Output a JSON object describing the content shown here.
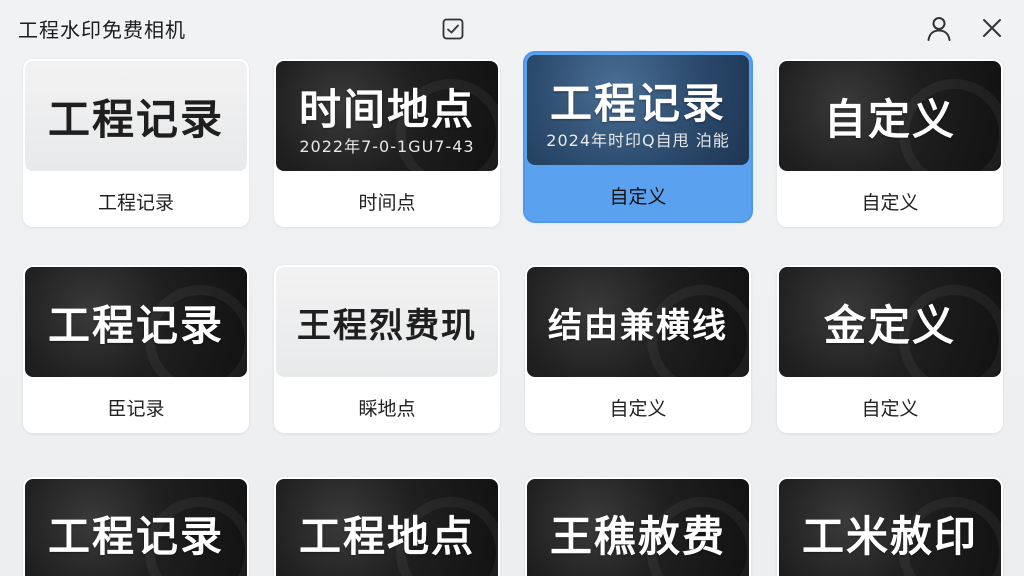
{
  "app": {
    "title": "工程水印免费相机"
  },
  "icons": {
    "check": "checkbox-icon",
    "user": "user-icon",
    "close": "close-icon"
  },
  "colors": {
    "accent": "#5aa2f0",
    "background": "#eef0f2",
    "card": "#ffffff"
  },
  "cards": [
    {
      "title": "工程记录",
      "sub": "",
      "label": "工程记录",
      "style": "light",
      "selected": false
    },
    {
      "title": "时间地点",
      "sub": "2022年7-0-1GU7-43",
      "label": "时间点",
      "style": "dark",
      "selected": false
    },
    {
      "title": "工程记录",
      "sub": "2024年时印Q自甩 泊能",
      "label": "自定义",
      "style": "blue",
      "selected": true
    },
    {
      "title": "自定义",
      "sub": "",
      "label": "自定义",
      "style": "dark",
      "selected": false
    },
    {
      "title": "工程记录",
      "sub": "",
      "label": "臣记录",
      "style": "dark",
      "selected": false
    },
    {
      "title": "王程烈费玑",
      "sub": "",
      "label": "睬地点",
      "style": "light",
      "selected": false
    },
    {
      "title": "结由兼横线",
      "sub": "",
      "label": "自定义",
      "style": "dark",
      "selected": false
    },
    {
      "title": "金定义",
      "sub": "",
      "label": "自定义",
      "style": "dark",
      "selected": false
    },
    {
      "title": "工程记录",
      "sub": "",
      "label": "",
      "style": "dark",
      "selected": false
    },
    {
      "title": "工程地点",
      "sub": "",
      "label": "",
      "style": "dark",
      "selected": false
    },
    {
      "title": "王穛赦费",
      "sub": "",
      "label": "",
      "style": "dark",
      "selected": false
    },
    {
      "title": "工米赦印",
      "sub": "",
      "label": "",
      "style": "dark",
      "selected": false
    }
  ]
}
